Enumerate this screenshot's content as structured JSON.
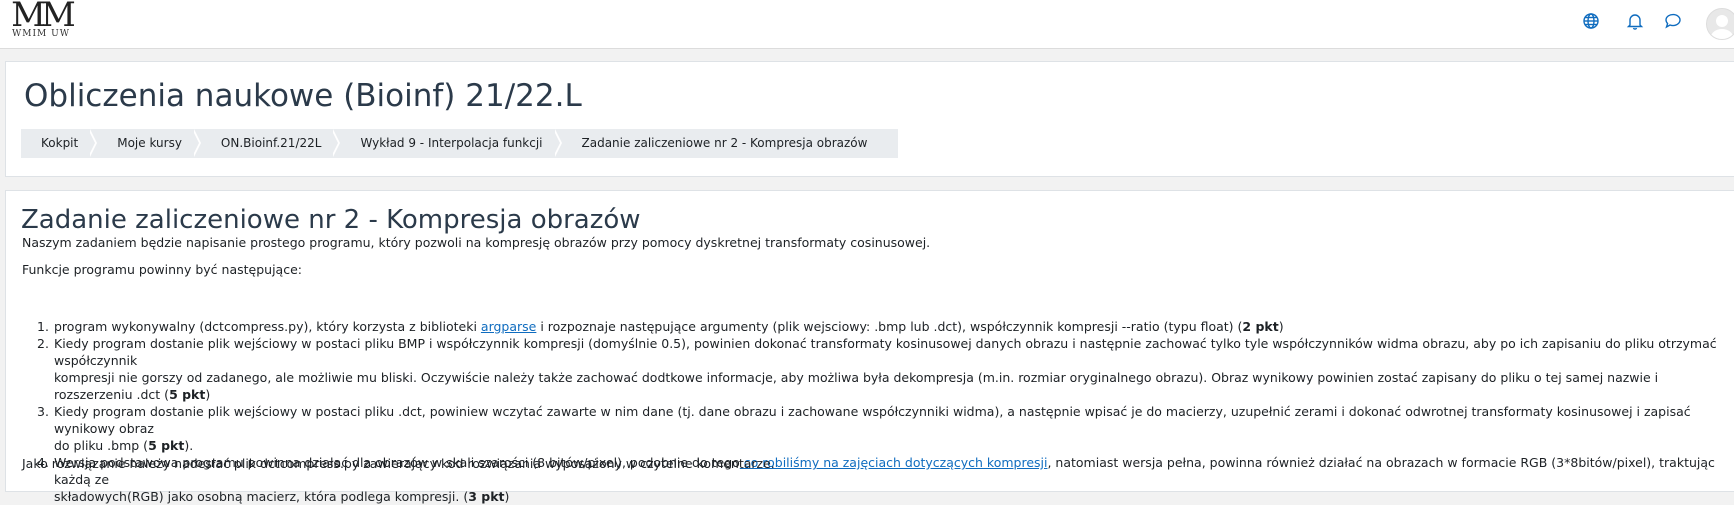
{
  "logo": {
    "mark": "MM",
    "subtitle": "WMIM UW"
  },
  "navbar": {
    "icons": [
      "globe-icon",
      "bell-icon",
      "chat-icon",
      "user-avatar-icon"
    ]
  },
  "course": {
    "title": "Obliczenia naukowe (Bioinf) 21/22.L",
    "breadcrumb": [
      "Kokpit",
      "Moje kursy",
      "ON.Bioinf.21/22L",
      "Wykład 9 - Interpolacja funkcji",
      "Zadanie zaliczeniowe nr 2 - Kompresja obrazów"
    ]
  },
  "assignment": {
    "heading": "Zadanie zaliczeniowe nr 2 - Kompresja obrazów",
    "intro": "Naszym zadaniem będzie napisanie prostego programu, który pozwoli na kompresję obrazów przy pomocy dyskretnej transformaty cosinusowej.",
    "functions_label": "Funkcje programu powinny być następujące:",
    "items": [
      {
        "num": "1.",
        "line1_pre": "program wykonywalny (dctcompress.py), który korzysta z biblioteki ",
        "line1_link": "argparse",
        "line1_post": " i rozpoznaje następujące argumenty (plik wejsciowy: .bmp lub .dct), współczynnik kompresji --ratio (typu float) (",
        "line1_bold": "2 pkt",
        "line1_end": ")"
      },
      {
        "num": "2.",
        "line1": "Kiedy program dostanie plik wejściowy w postaci pliku BMP i współczynnik kompresji (domyślnie 0.5), powinien dokonać transformaty kosinusowej danych obrazu i następnie zachować tylko tyle współczynników widma obrazu, aby po ich zapisaniu do pliku otrzymać współczynnik",
        "line2_pre": "kompresji nie gorszy od zadanego, ale możliwie mu bliski. Oczywiście należy także zachować dodtkowe informacje, aby możliwa była dekompresja (m.in. rozmiar oryginalnego obrazu). Obraz wynikowy powinien zostać zapisany do pliku o tej samej nazwie i rozszerzeniu .dct (",
        "line2_bold": "5 pkt",
        "line2_end": ")"
      },
      {
        "num": "3.",
        "line1": "Kiedy program dostanie plik wejściowy w postaci pliku .dct, powiniew wczytać zawarte w nim dane (tj. dane obrazu i zachowane współczynniki widma), a następnie wpisać je do macierzy, uzupełnić zerami i dokonać odwrotnej transformaty kosinusowej i zapisać wynikowy obraz",
        "line2_pre": "do pliku .bmp (",
        "line2_bold": "5 pkt",
        "line2_end": ")."
      },
      {
        "num": "4.",
        "line1_pre": "Wersja podstawowa programu powinna działać dla obrazów w skali szarości (8 bitów/pixel), podobnie do tego",
        "line1_link": " co robiliśmy na zajęciach dotyczących kompresji",
        "line1_post": ", natomiast wersja pełna, powinna również działać na obrazach w formacie RGB (3*8bitów/pixel), traktując każdą ze",
        "line2_pre": "składowych(RGB) jako osobną macierz, która podlega kompresji. (",
        "line2_bold": "3 pkt",
        "line2_end": ")"
      }
    ],
    "closing": "Jako rozwiązanie należy nadesłać plik dctcompress.py zawierający kod rozwiązania wyposażony w czytelne komentarze."
  }
}
